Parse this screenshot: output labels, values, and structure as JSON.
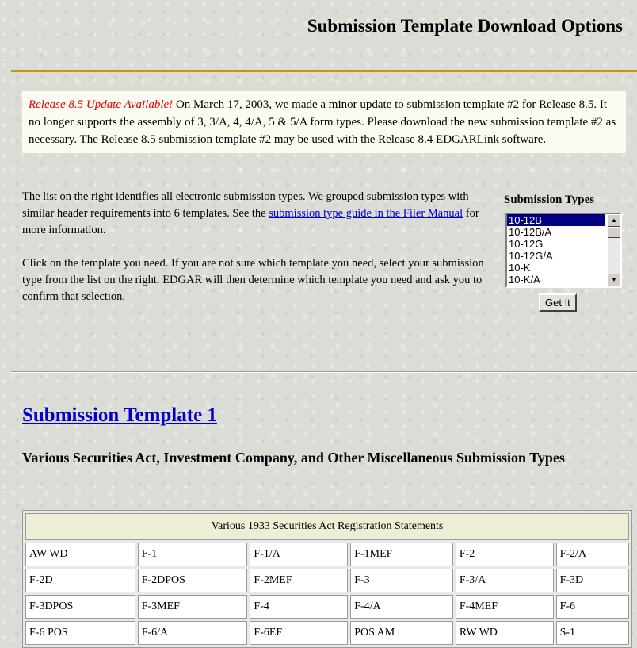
{
  "page": {
    "title": "Submission Template Download Options"
  },
  "update_notice": {
    "highlight": "Release 8.5 Update Available!",
    "text": " On March 17, 2003, we made a minor update to submission template #2 for Release 8.5. It no longer supports the assembly of 3, 3/A, 4, 4/A, 5 & 5/A form types. Please download the new submission template #2 as necessary. The Release 8.5 submission template #2 may be used with the Release 8.4 EDGARLink software."
  },
  "intro": {
    "p1_before": "The list on the right identifies all electronic submission types. We grouped submission types with similar header requirements into 6 templates. See the ",
    "p1_link": "submission type guide in the Filer Manual",
    "p1_after": " for more information.",
    "p2": "Click on the template you need. If you are not sure which template you need, select your submission type from the list on the right. EDGAR will then determine which template you need and ask you to confirm that selection."
  },
  "submission_types": {
    "heading": "Submission Types",
    "options": [
      "10-12B",
      "10-12B/A",
      "10-12G",
      "10-12G/A",
      "10-K",
      "10-K/A"
    ],
    "selected": "10-12B",
    "button_label": "Get It"
  },
  "template1": {
    "heading": "Submission Template 1",
    "subheading": "Various Securities Act, Investment Company, and Other Miscellaneous Submission Types",
    "table_caption": "Various 1933 Securities Act Registration Statements",
    "rows": [
      [
        "AW WD",
        "F-1",
        "F-1/A",
        "F-1MEF",
        "F-2",
        "F-2/A"
      ],
      [
        "F-2D",
        "F-2DPOS",
        "F-2MEF",
        "F-3",
        "F-3/A",
        "F-3D"
      ],
      [
        "F-3DPOS",
        "F-3MEF",
        "F-4",
        "F-4/A",
        "F-4MEF",
        "F-6"
      ],
      [
        "F-6 POS",
        "F-6/A",
        "F-6EF",
        "POS AM",
        "RW WD",
        "S-1"
      ]
    ]
  },
  "icons": {
    "scroll_up": "scroll-up-arrow-icon",
    "scroll_down": "scroll-down-arrow-icon"
  },
  "colors": {
    "rule": "#c8960a",
    "highlight": "#e00000",
    "link": "#0000cc",
    "selection": "#000080"
  }
}
